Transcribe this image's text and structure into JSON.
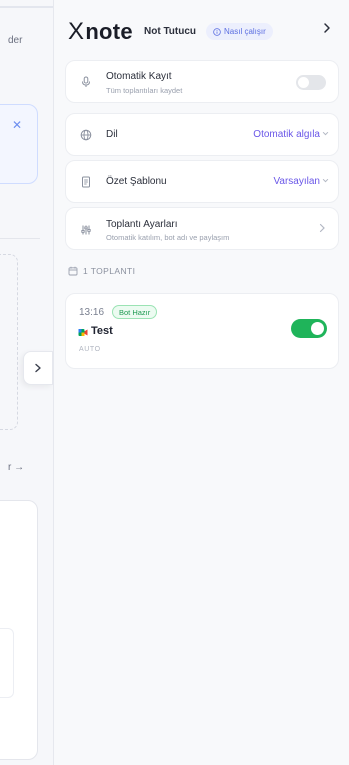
{
  "background_page": {
    "text_top": "der",
    "close_icon": "close-icon",
    "text_bottom": "r →"
  },
  "collapse_button": {
    "icon": "chevron-right-icon"
  },
  "header": {
    "logo": "Xnote",
    "logo_x": "X",
    "logo_rest": "note",
    "title": "Not Tutucu",
    "how_it_works": "Nasıl çalışır",
    "how_icon": "info-circle-icon",
    "chevron_icon": "chevron-right-icon"
  },
  "settings": {
    "auto_record": {
      "label": "Otomatik Kayıt",
      "sub": "Tüm toplantıları kaydet",
      "enabled": false,
      "icon": "microphone-icon"
    },
    "language": {
      "label": "Dil",
      "value": "Otomatik algıla",
      "icon": "globe-icon"
    },
    "summary_template": {
      "label": "Özet Şablonu",
      "value": "Varsayılan",
      "icon": "document-icon"
    },
    "meeting_settings": {
      "label": "Toplantı Ayarları",
      "sub": "Otomatik katılım, bot adı ve paylaşım",
      "icon": "settings-sliders-icon"
    }
  },
  "meetings_section": {
    "header": "1 TOPLANTI",
    "icon": "calendar-icon"
  },
  "meetings": [
    {
      "time": "13:16",
      "badge": "Bot Hazır",
      "name": "Test",
      "mode": "AUTO",
      "enabled": true,
      "platform_icon": "google-meet-icon"
    }
  ],
  "colors": {
    "accent": "#6a57e8",
    "success": "#1fb45a",
    "panel_bg": "#f8f9fb"
  }
}
